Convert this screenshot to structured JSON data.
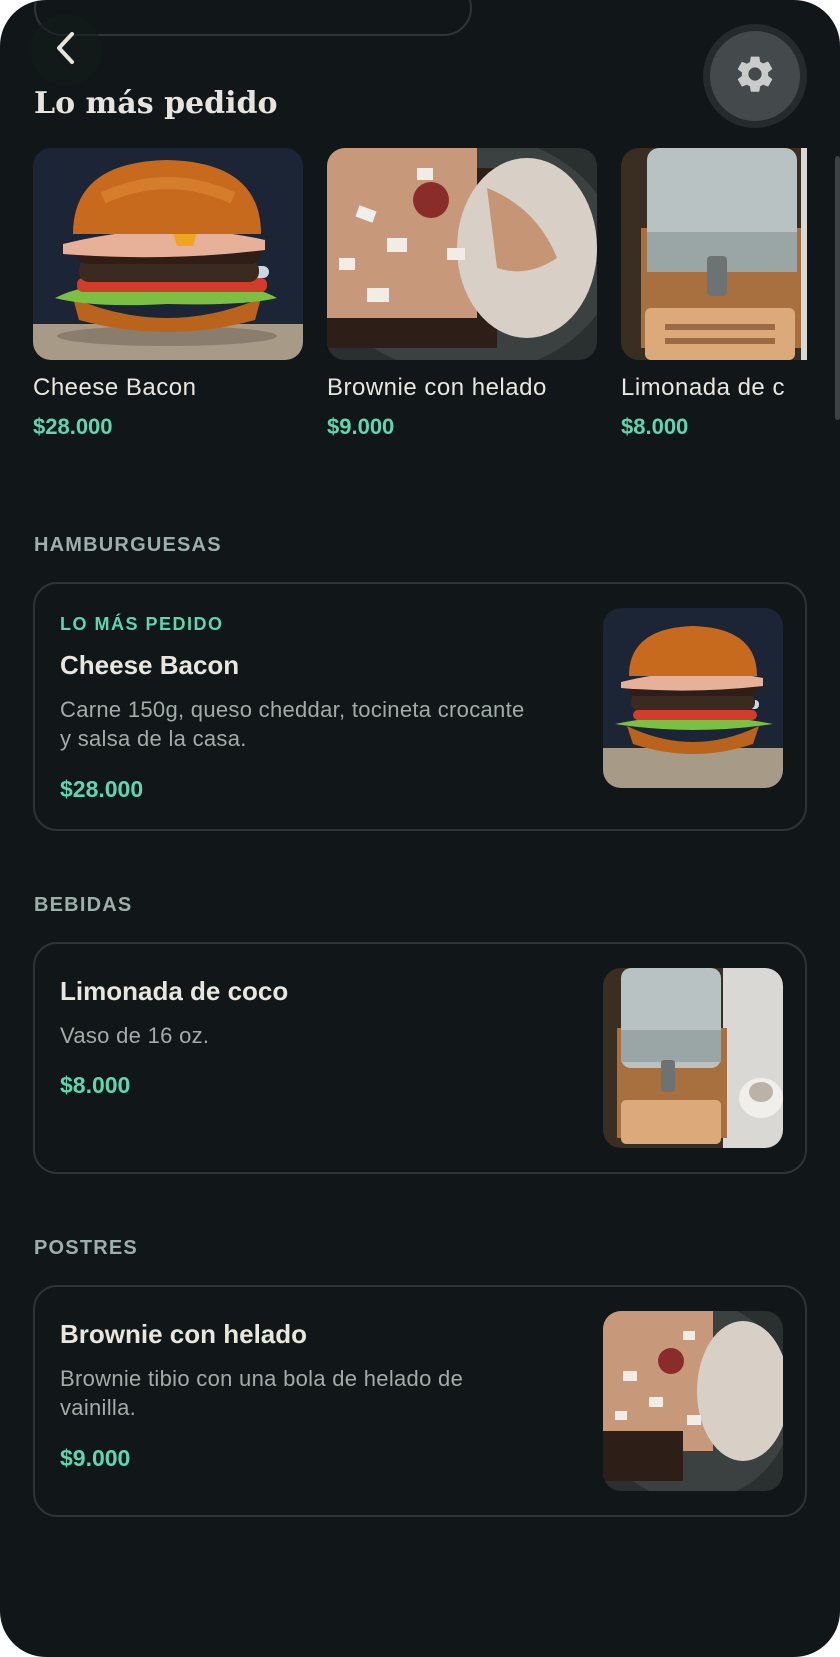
{
  "header": {
    "back_icon": "chevron-left-icon",
    "settings_icon": "gear-icon"
  },
  "top_section": {
    "title": "Lo más pedido",
    "items": [
      {
        "name": "Cheese Bacon",
        "price": "$28.000",
        "image": "burger"
      },
      {
        "name": "Brownie con helado",
        "price": "$9.000",
        "image": "brownie"
      },
      {
        "name": "Limonada de c",
        "price": "$8.000",
        "image": "lemonade"
      }
    ]
  },
  "categories": [
    {
      "label": "HAMBURGUESAS",
      "items": [
        {
          "tag": "LO MÁS PEDIDO",
          "name": "Cheese Bacon",
          "description": "Carne 150g, queso cheddar, tocineta crocante y salsa de la casa.",
          "price": "$28.000",
          "image": "burger"
        }
      ]
    },
    {
      "label": "BEBIDAS",
      "items": [
        {
          "name": "Limonada de coco",
          "description": "Vaso de 16 oz.",
          "price": "$8.000",
          "image": "lemonade"
        }
      ]
    },
    {
      "label": "POSTRES",
      "items": [
        {
          "name": "Brownie con helado",
          "description": "Brownie tibio con una bola de helado de vainilla.",
          "price": "$9.000",
          "image": "brownie"
        }
      ]
    }
  ],
  "colors": {
    "background": "#111718",
    "accent": "#5fd6ad",
    "text": "#e9e6df",
    "muted": "#a3aca9"
  }
}
